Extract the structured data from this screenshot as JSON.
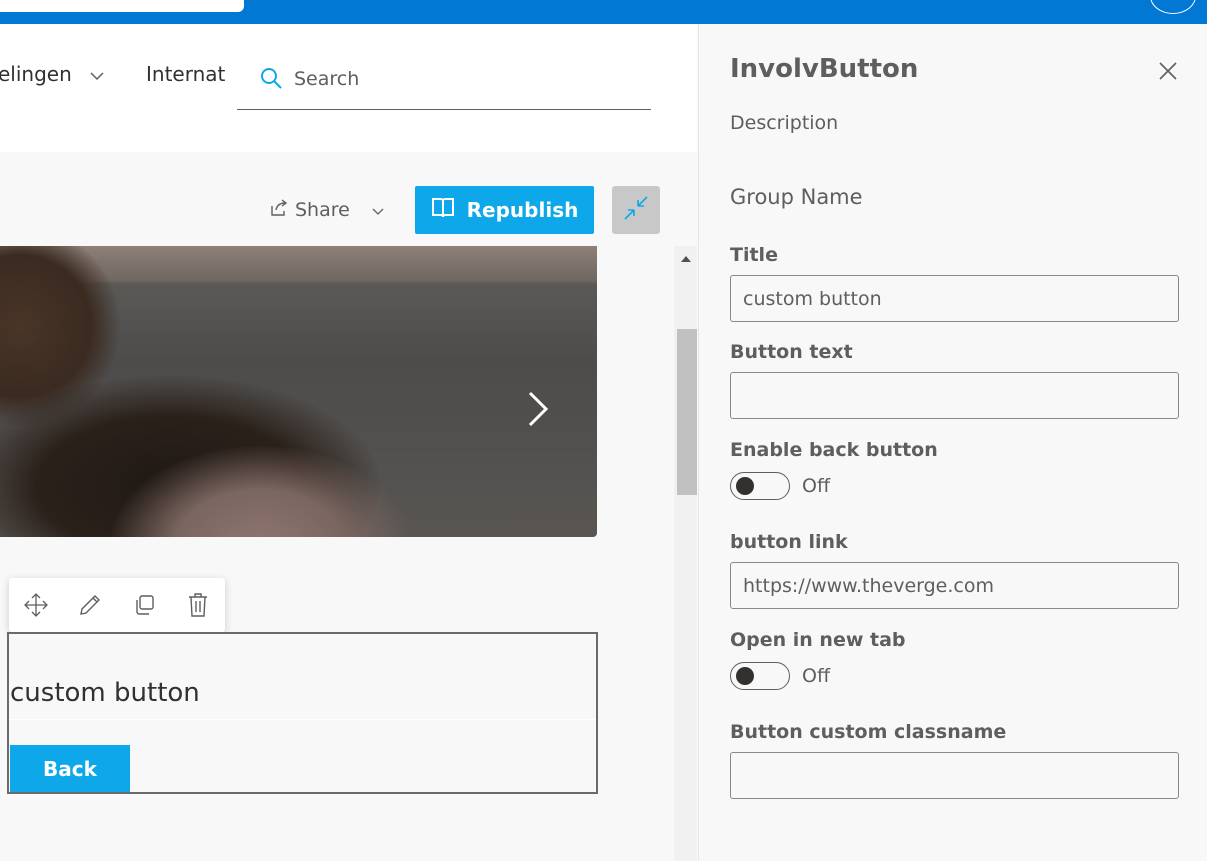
{
  "site_nav": {
    "item_1": "elingen",
    "item_2": "International",
    "search_placeholder": "Search"
  },
  "command_bar": {
    "share_label": "Share",
    "republish_label": "Republish"
  },
  "webpart": {
    "title": "custom button",
    "back_label": "Back"
  },
  "property_pane": {
    "title": "InvolvButton",
    "description": "Description",
    "group_name": "Group Name",
    "fields": {
      "title_label": "Title",
      "title_value": "custom button",
      "button_text_label": "Button text",
      "button_text_value": "",
      "enable_back_label": "Enable back button",
      "enable_back_state": "Off",
      "button_link_label": "button link",
      "button_link_value": "https://www.theverge.com",
      "open_new_tab_label": "Open in new tab",
      "open_new_tab_state": "Off",
      "custom_classname_label": "Button custom classname",
      "custom_classname_value": ""
    }
  },
  "colors": {
    "suite_bar": "#0078d4",
    "accent": "#0ea8ea"
  },
  "icons": [
    "search-icon",
    "share-icon",
    "chevron-down-icon",
    "book-icon",
    "collapse-icon",
    "chevron-right-icon",
    "move-icon",
    "edit-icon",
    "duplicate-icon",
    "delete-icon",
    "close-icon"
  ]
}
